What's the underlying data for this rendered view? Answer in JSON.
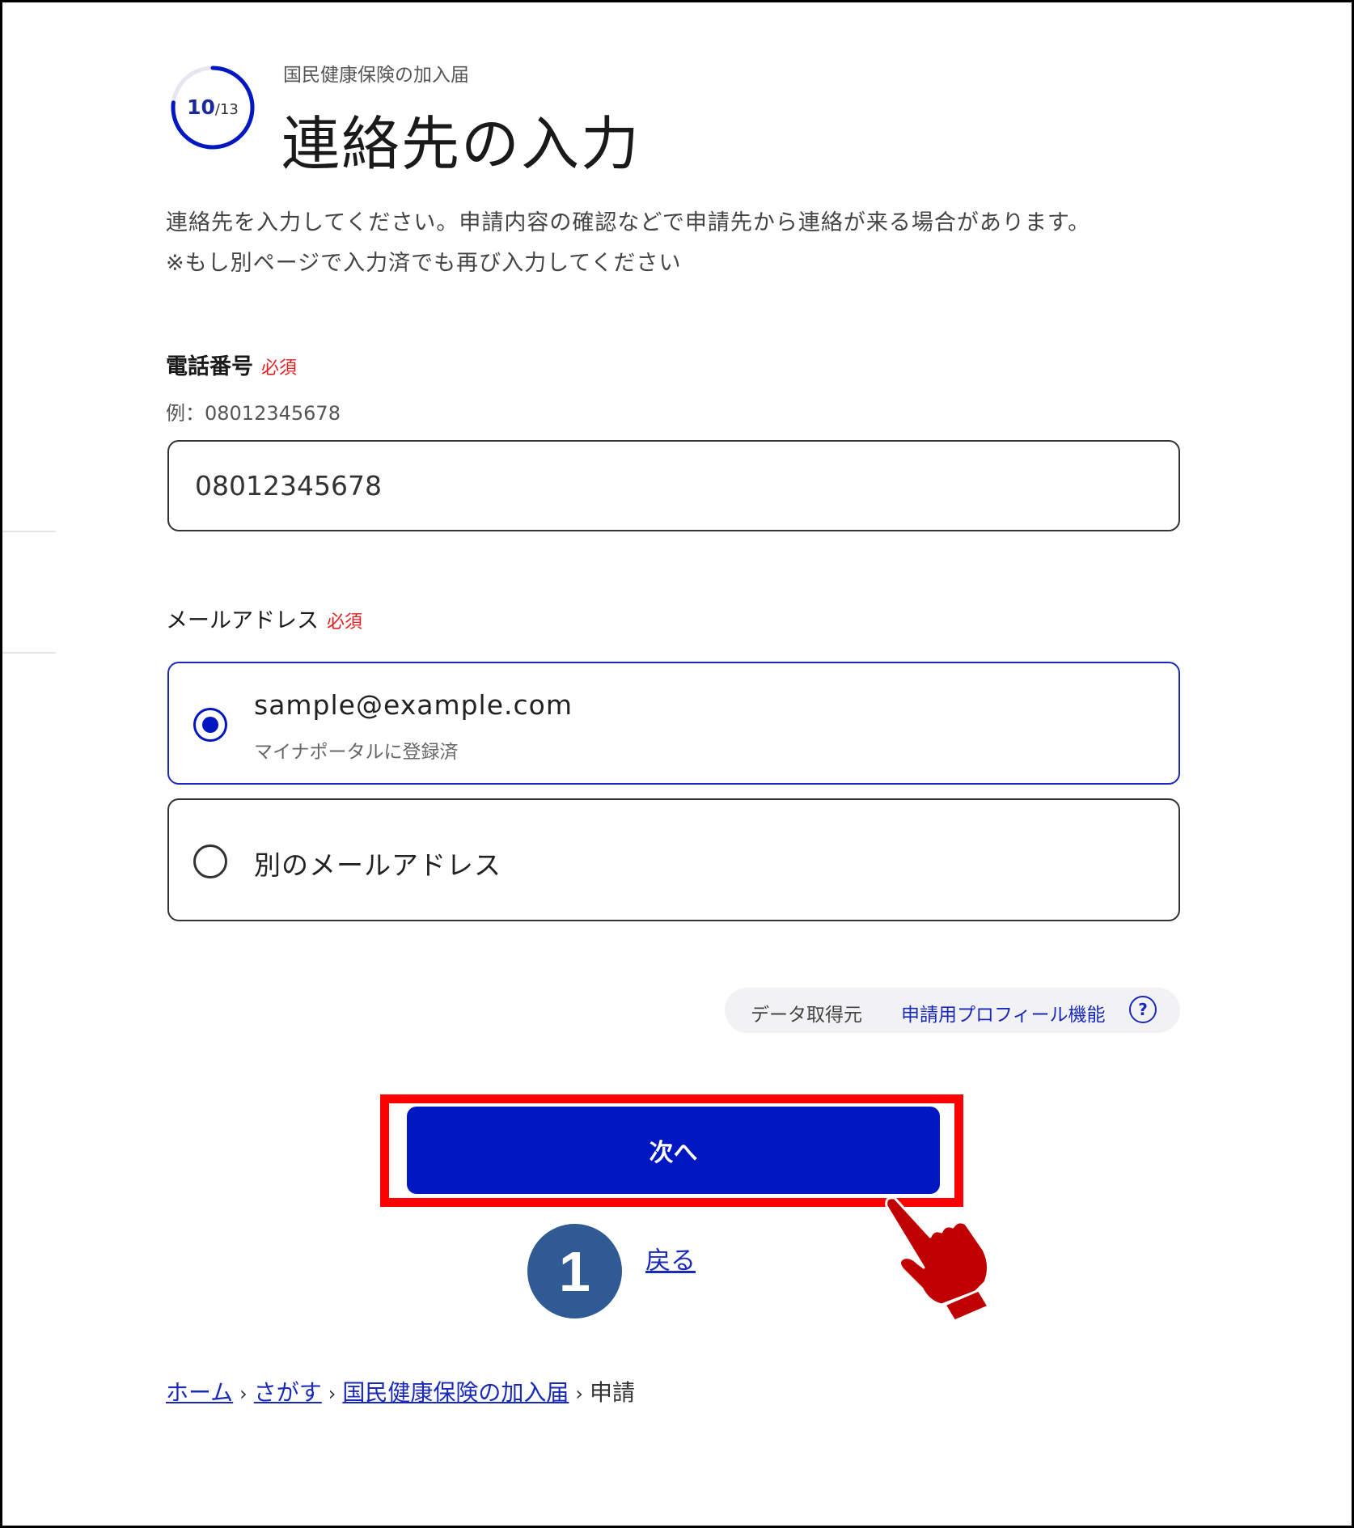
{
  "progress": {
    "current": "10",
    "total": "/13",
    "fraction": 0.769
  },
  "header": {
    "supertitle": "国民健康保険の加入届",
    "title": "連絡先の入力"
  },
  "description": {
    "line1": "連絡先を入力してください。申請内容の確認などで申請先から連絡が来る場合があります。",
    "line2": "※もし別ページで入力済でも再び入力してください"
  },
  "phone": {
    "label": "電話番号",
    "required": "必須",
    "example": "例：08012345678",
    "value": "08012345678"
  },
  "email": {
    "label": "メールアドレス",
    "required": "必須",
    "option1": {
      "value": "sample@example.com",
      "sub": "マイナポータルに登録済",
      "selected": true
    },
    "option2": {
      "label": "別のメールアドレス",
      "selected": false
    }
  },
  "data_source": {
    "label": "データ取得元",
    "link": "申請用プロフィール機能",
    "help_icon": "?"
  },
  "actions": {
    "next": "次へ",
    "back": "戻る"
  },
  "annotation": {
    "step_number": "1"
  },
  "breadcrumb": {
    "items": [
      "ホーム",
      "さがす",
      "国民健康保険の加入届"
    ],
    "current": "申請",
    "separator": "›"
  },
  "colors": {
    "primary": "#0017c1",
    "required": "#e02020",
    "highlight": "#ff0000",
    "badge": "#2f5a94",
    "pointer": "#c00000"
  }
}
